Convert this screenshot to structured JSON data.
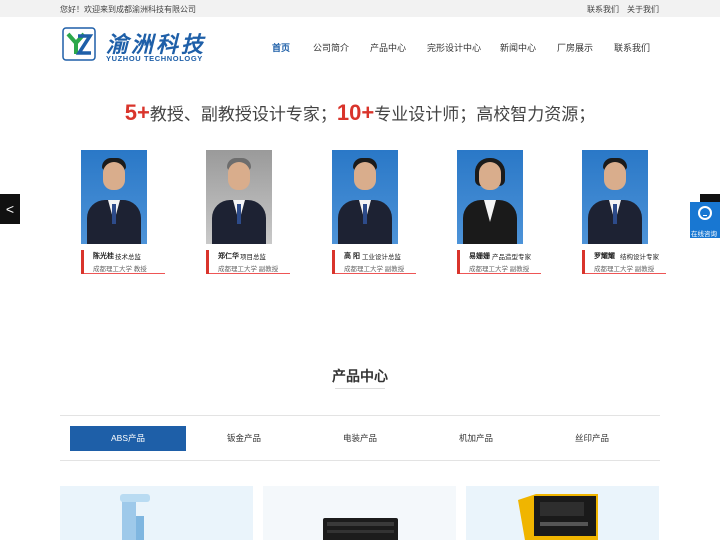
{
  "topbar": {
    "welcome": "您好！欢迎来到成都渝洲科技有限公司",
    "contact": "联系我们",
    "about": "关于我们"
  },
  "logo": {
    "cn": "渝洲科技",
    "en": "YUZHOU TECHNOLOGY",
    "letters": "YZ"
  },
  "nav": [
    "首页",
    "公司简介",
    "产品中心",
    "完形设计中心",
    "新闻中心",
    "厂房展示",
    "联系我们"
  ],
  "slogan": {
    "num1": "5+",
    "text1": "教授、副教授设计专家；",
    "num2": "10+",
    "text2": "专业设计师；高校智力资源；"
  },
  "experts": [
    {
      "name": "陈光桂",
      "title": "技术总监",
      "org": "成都理工大学 教授"
    },
    {
      "name": "郑仁华",
      "title": "项目总监",
      "org": "成都理工大学 副教授"
    },
    {
      "name": "高 阳",
      "title": "工业设计总监",
      "org": "成都理工大学 副教授"
    },
    {
      "name": "易姗姗",
      "title": "产品造型专家",
      "org": "成都理工大学 副教授"
    },
    {
      "name": "罗耀耀",
      "title": "结构设计专家",
      "org": "成都理工大学 副教授"
    }
  ],
  "side": {
    "prev_arrow": "<",
    "service_label": "在线咨询"
  },
  "products": {
    "title": "产品中心",
    "tabs": [
      "ABS产品",
      "钣金产品",
      "电装产品",
      "机加产品",
      "丝印产品"
    ],
    "active_tab": "ABS产品"
  },
  "colors": {
    "brand": "#1e5fa8",
    "accent_red": "#d9342b",
    "service_blue": "#1877d2"
  }
}
